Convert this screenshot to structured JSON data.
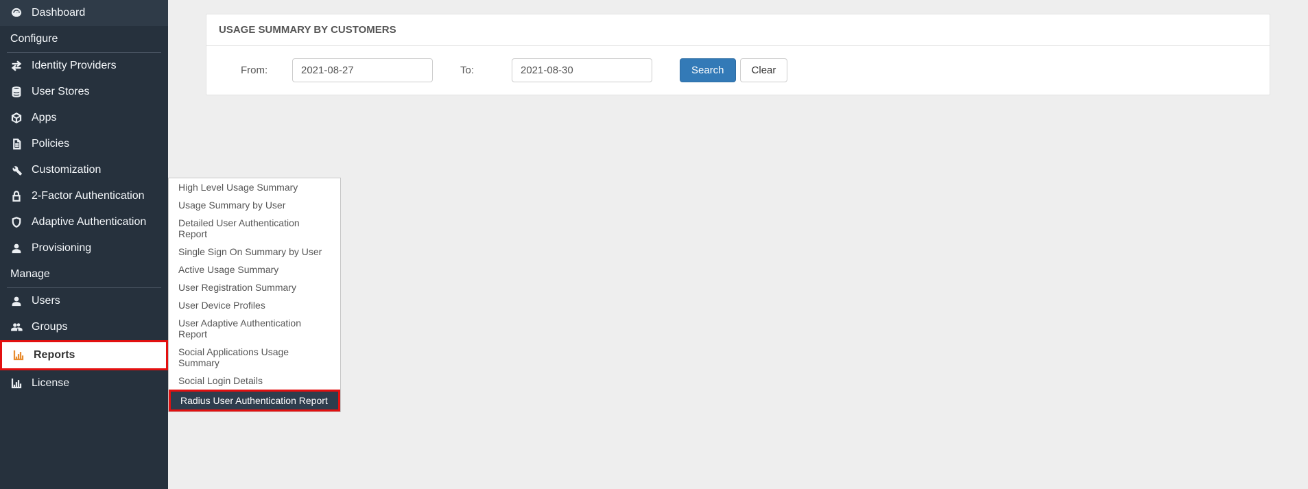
{
  "sidebar": {
    "dashboard": "Dashboard",
    "section_configure": "Configure",
    "identity_providers": "Identity Providers",
    "user_stores": "User Stores",
    "apps": "Apps",
    "policies": "Policies",
    "customization": "Customization",
    "two_factor": "2-Factor Authentication",
    "adaptive_auth": "Adaptive Authentication",
    "provisioning": "Provisioning",
    "section_manage": "Manage",
    "users": "Users",
    "groups": "Groups",
    "reports": "Reports",
    "license": "License"
  },
  "submenu": {
    "items": [
      "High Level Usage Summary",
      "Usage Summary by User",
      "Detailed User Authentication Report",
      "Single Sign On Summary by User",
      "Active Usage Summary",
      "User Registration Summary",
      "User Device Profiles",
      "User Adaptive Authentication Report",
      "Social Applications Usage Summary",
      "Social Login Details",
      "Radius User Authentication Report"
    ]
  },
  "main": {
    "panel_title": "USAGE SUMMARY BY CUSTOMERS",
    "from_label": "From:",
    "to_label": "To:",
    "from_value": "2021-08-27",
    "to_value": "2021-08-30",
    "search_btn": "Search",
    "clear_btn": "Clear"
  }
}
